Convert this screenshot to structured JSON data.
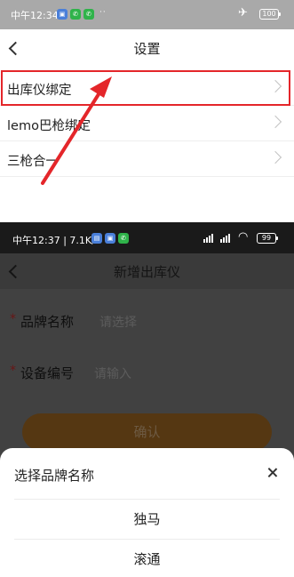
{
  "screen1": {
    "status_bar": {
      "time": "中午12:34",
      "battery": "100",
      "app_icons": [
        "nfc-pay-icon",
        "wechat-icon",
        "phone-icon"
      ]
    },
    "header": {
      "title": "设置"
    },
    "settings_items": [
      {
        "label": "出库仪绑定",
        "highlighted": true
      },
      {
        "label": "lemo巴枪绑定"
      },
      {
        "label": "三枪合一"
      }
    ],
    "annotation": {
      "highlight_color": "#e4262a",
      "arrow_color": "#e4262a"
    }
  },
  "screen2": {
    "status_bar": {
      "time": "中午12:37 | 7.1K/s",
      "battery": "99",
      "app_icons": [
        "message-icon",
        "nfc-pay-icon",
        "wechat-icon"
      ]
    },
    "header": {
      "title": "新增出库仪"
    },
    "form": {
      "brand_label": "品牌名称",
      "brand_placeholder": "请选择",
      "device_label": "设备编号",
      "device_placeholder": "请输入",
      "required_mark": "*"
    },
    "confirm_button": "确认",
    "picker": {
      "title": "选择品牌名称",
      "options": [
        "独马",
        "滚通"
      ]
    }
  },
  "colors": {
    "accent": "#f08a1c",
    "dim_overlay": "#000000"
  }
}
